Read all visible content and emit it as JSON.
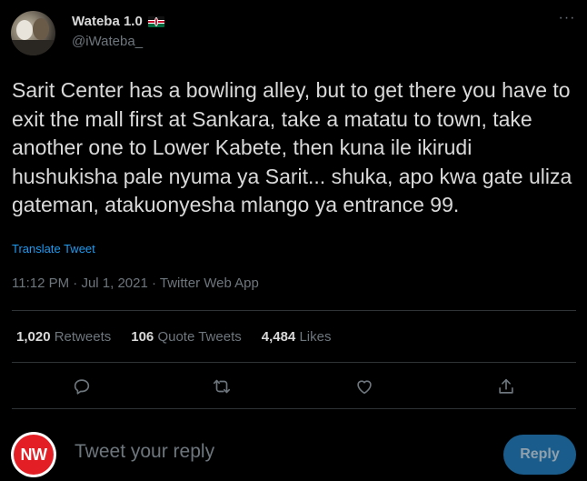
{
  "author": {
    "display_name": "Wateba 1.0",
    "handle": "@iWateba_",
    "flag_icon": "kenya-flag-icon"
  },
  "more_label": "···",
  "tweet": {
    "text": "Sarit Center has a bowling alley, but to get there you have to exit the mall first at Sankara, take a matatu to town, take another one to Lower Kabete, then kuna ile ikirudi hushukisha pale nyuma ya Sarit... shuka, apo kwa gate uliza gateman, atakuonyesha mlango ya entrance 99.",
    "translate_label": "Translate Tweet",
    "time": "11:12 PM",
    "date": "Jul 1, 2021",
    "source": "Twitter Web App",
    "separator": " · "
  },
  "stats": {
    "retweets": {
      "count": "1,020",
      "label": "Retweets"
    },
    "quotes": {
      "count": "106",
      "label": "Quote Tweets"
    },
    "likes": {
      "count": "4,484",
      "label": "Likes"
    }
  },
  "actions": [
    "reply-icon",
    "retweet-icon",
    "like-icon",
    "share-icon"
  ],
  "composer": {
    "avatar_text": "NW",
    "placeholder": "Tweet your reply",
    "button_label": "Reply"
  },
  "colors": {
    "background": "#000000",
    "text": "#d9d9d9",
    "secondary": "#6e767d",
    "accent": "#1d9bf0",
    "reply_button": "#1a5d8c",
    "avatar_red": "#e31e24"
  }
}
